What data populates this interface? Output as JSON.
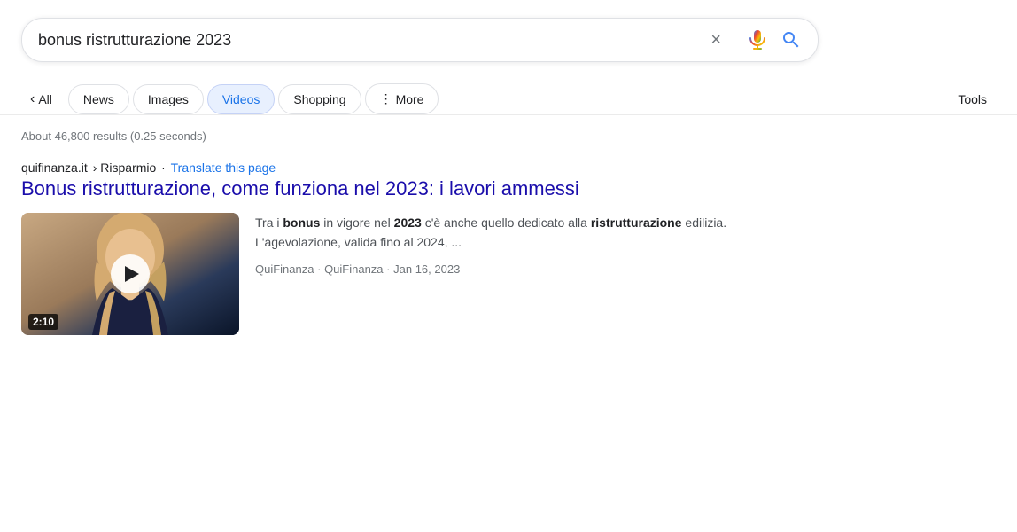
{
  "search": {
    "query": "bonus ristrutturazione 2023",
    "clear_label": "×",
    "placeholder": ""
  },
  "filters": {
    "back_label": "All",
    "tabs": [
      {
        "id": "news",
        "label": "News",
        "active": false
      },
      {
        "id": "images",
        "label": "Images",
        "active": false
      },
      {
        "id": "videos",
        "label": "Videos",
        "active": true
      },
      {
        "id": "shopping",
        "label": "Shopping",
        "active": false
      },
      {
        "id": "more",
        "label": "More",
        "active": false,
        "has_dots": true
      }
    ],
    "tools_label": "Tools"
  },
  "results": {
    "count_text": "About 46,800 results (0.25 seconds)",
    "items": [
      {
        "domain": "quifinanza.it",
        "breadcrumb": "› Risparmio",
        "translate_label": "Translate this page",
        "title": "Bonus ristrutturazione, come funziona nel 2023: i lavori ammessi",
        "url": "#",
        "snippet_parts": [
          {
            "text": "Tra i "
          },
          {
            "text": "bonus",
            "bold": true
          },
          {
            "text": " in vigore nel "
          },
          {
            "text": "2023",
            "bold": true
          },
          {
            "text": " c'è anche quello dedicato alla "
          },
          {
            "text": "ristrutturazione",
            "bold": true
          },
          {
            "text": " edilizia. L'agevolazione, valida fino al 2024, ..."
          }
        ],
        "video_duration": "2:10",
        "publisher": "QuiFinanza",
        "source": "QuiFinanza",
        "date": "Jan 16, 2023"
      }
    ]
  },
  "icons": {
    "mic": "🎤",
    "search": "🔍"
  }
}
